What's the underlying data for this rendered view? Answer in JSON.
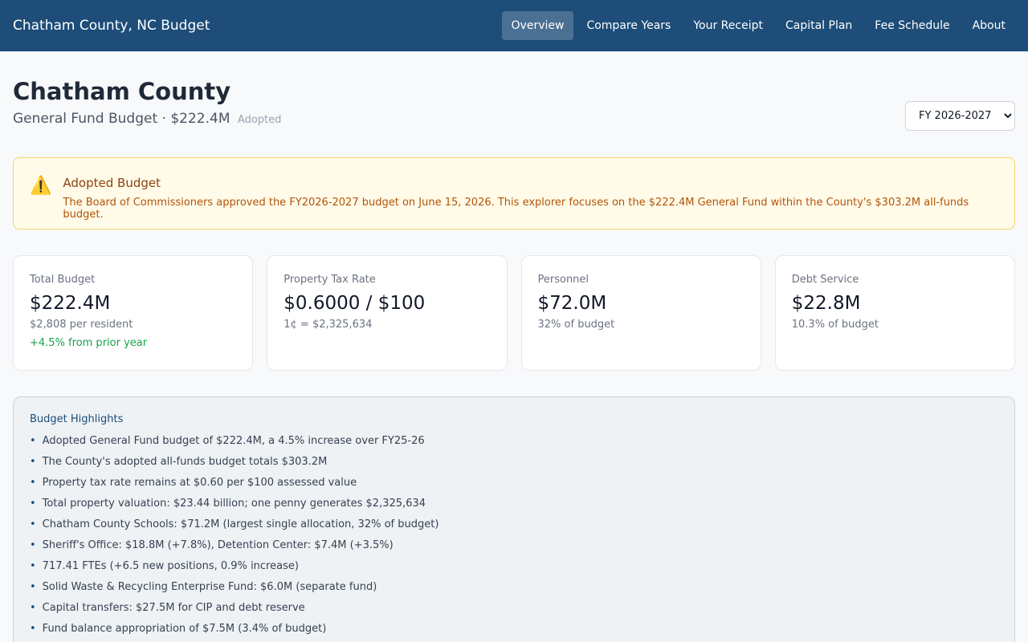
{
  "header": {
    "brand": "Chatham County, NC Budget",
    "nav": [
      {
        "label": "Overview",
        "active": true
      },
      {
        "label": "Compare Years",
        "active": false
      },
      {
        "label": "Your Receipt",
        "active": false
      },
      {
        "label": "Capital Plan",
        "active": false
      },
      {
        "label": "Fee Schedule",
        "active": false
      },
      {
        "label": "About",
        "active": false
      }
    ]
  },
  "page": {
    "title": "Chatham County",
    "subtitle": "General Fund Budget · $222.4M",
    "status": "Adopted",
    "year_select": {
      "selected": "FY 2026-2027"
    }
  },
  "alert": {
    "icon": "warning-icon",
    "title": "Adopted Budget",
    "text": "The Board of Commissioners approved the FY2026-2027 budget on June 15, 2026. This explorer focuses on the $222.4M General Fund within the County's $303.2M all-funds budget."
  },
  "cards": [
    {
      "label": "Total Budget",
      "value": "$222.4M",
      "sub": "$2,808 per resident",
      "change": "+4.5% from prior year"
    },
    {
      "label": "Property Tax Rate",
      "value": "$0.6000 / $100",
      "sub": "1¢ = $2,325,634",
      "change": ""
    },
    {
      "label": "Personnel",
      "value": "$72.0M",
      "sub": "32% of budget",
      "change": ""
    },
    {
      "label": "Debt Service",
      "value": "$22.8M",
      "sub": "10.3% of budget",
      "change": ""
    }
  ],
  "highlights": {
    "title": "Budget Highlights",
    "items": [
      "Adopted General Fund budget of $222.4M, a 4.5% increase over FY25-26",
      "The County's adopted all-funds budget totals $303.2M",
      "Property tax rate remains at $0.60 per $100 assessed value",
      "Total property valuation: $23.44 billion; one penny generates $2,325,634",
      "Chatham County Schools: $71.2M (largest single allocation, 32% of budget)",
      "Sheriff's Office: $18.8M (+7.8%), Detention Center: $7.4M (+3.5%)",
      "717.41 FTEs (+6.5 new positions, 0.9% increase)",
      "Solid Waste & Recycling Enterprise Fund: $6.0M (separate fund)",
      "Capital transfers: $27.5M for CIP and debt reserve",
      "Fund balance appropriation of $7.5M (3.4% of budget)"
    ]
  },
  "colors": {
    "header_bg": "#1d4d78",
    "alert_border": "#f3d66a",
    "alert_bg": "#fffbe8",
    "positive": "#16a34a"
  }
}
